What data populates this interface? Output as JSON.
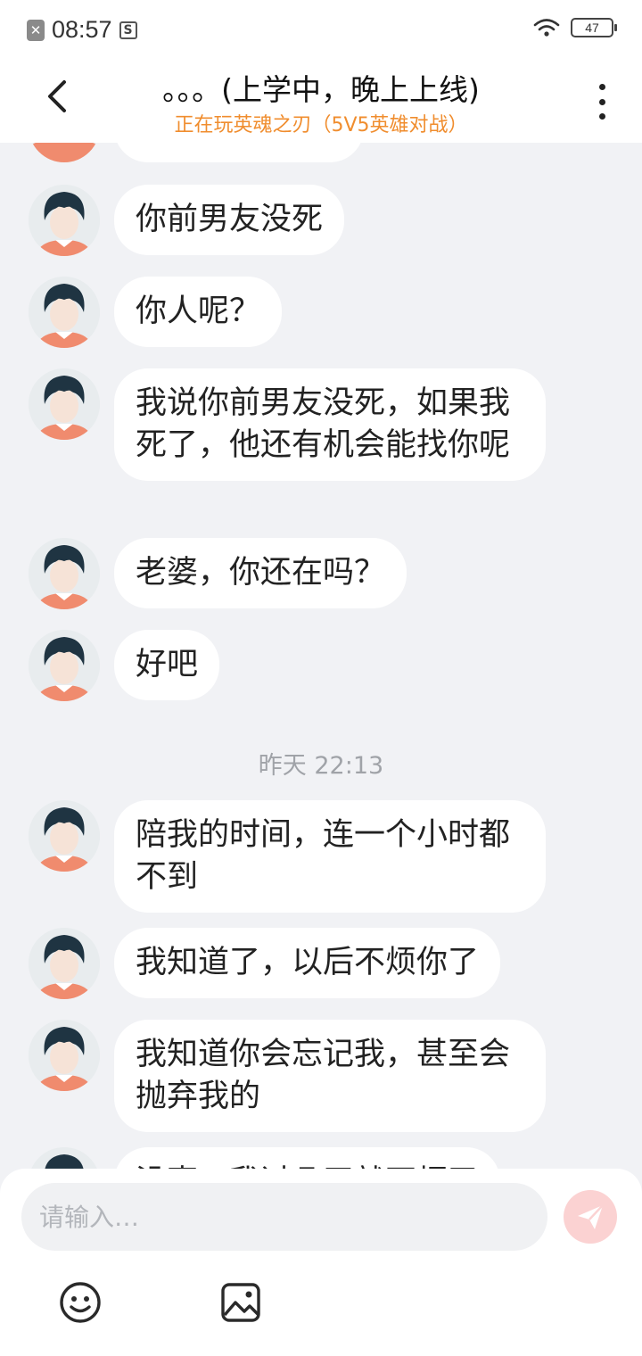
{
  "status_bar": {
    "time": "08:57",
    "battery": "47"
  },
  "header": {
    "title": "。。。(上学中，晚上上线)",
    "subtitle": "正在玩英魂之刃（5V5英雄对战）"
  },
  "messages": [
    {
      "text": "你前男友没死"
    },
    {
      "text": "你人呢？"
    },
    {
      "text": "我说你前男友没死，如果我死了，他还有机会能找你呢"
    },
    {
      "text": "老婆，你还在吗？"
    },
    {
      "text": "好吧"
    },
    {
      "text": "陪我的时间，连一个小时都不到"
    },
    {
      "text": "我知道了，以后不烦你了"
    },
    {
      "text": "我知道你会忘记我，甚至会抛弃我的"
    },
    {
      "text": "没事，我过几天就不烦了"
    }
  ],
  "timestamp": "昨天 22:13",
  "input": {
    "placeholder": "请输入…"
  },
  "colors": {
    "accent_orange": "#f08d2e",
    "send_button": "#fbd2d2",
    "chat_background": "#f1f2f5"
  },
  "icons": {
    "back": "chevron-left-icon",
    "more": "more-vertical-icon",
    "send": "paper-plane-icon",
    "emoji": "smiley-icon",
    "image": "image-icon"
  }
}
